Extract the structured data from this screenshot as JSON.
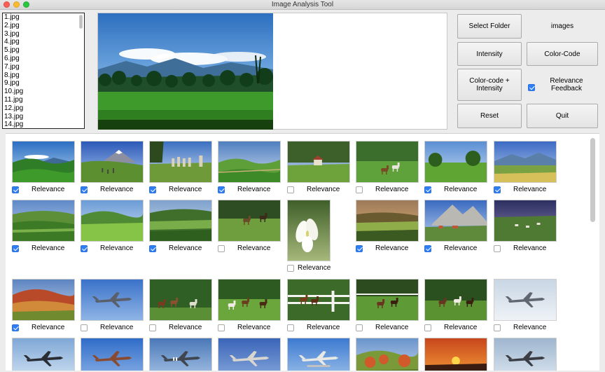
{
  "window": {
    "title": "Image Analysis Tool"
  },
  "file_list": [
    "1.jpg",
    "2.jpg",
    "3.jpg",
    "4.jpg",
    "5.jpg",
    "6.jpg",
    "7.jpg",
    "8.jpg",
    "9.jpg",
    "10.jpg",
    "11.jpg",
    "12.jpg",
    "13.jpg",
    "14.jpg"
  ],
  "controls": {
    "select_folder": "Select Folder",
    "folder_name": "images",
    "intensity": "Intensity",
    "color_code": "Color-Code",
    "color_code_intensity": "Color-code + Intensity",
    "relevance_feedback": "Relevance Feedback",
    "relevance_feedback_checked": true,
    "reset": "Reset",
    "quit": "Quit"
  },
  "gallery": {
    "relevance_label": "Relevance",
    "rows": [
      [
        {
          "scene": "blue-mountain",
          "checked": true
        },
        {
          "scene": "snow-mountain",
          "checked": true
        },
        {
          "scene": "stones-field",
          "checked": true
        },
        {
          "scene": "green-hills",
          "checked": true
        },
        {
          "scene": "tree-house",
          "checked": false
        },
        {
          "scene": "horse-field",
          "checked": false
        },
        {
          "scene": "meadow-trees",
          "checked": true
        },
        {
          "scene": "mountain-lake",
          "checked": true
        }
      ],
      [
        {
          "scene": "rolling-green",
          "checked": true
        },
        {
          "scene": "valley-meadow",
          "checked": true
        },
        {
          "scene": "patchwork-fields",
          "checked": true
        },
        {
          "scene": "rider-field",
          "checked": false
        },
        {
          "scene": "white-flower",
          "checked": false
        },
        {
          "scene": "sunset-fields",
          "checked": true
        },
        {
          "scene": "alpine-village",
          "checked": true
        },
        {
          "scene": "cattle-dusk",
          "checked": false
        }
      ],
      [
        {
          "scene": "red-hills",
          "checked": true
        },
        {
          "scene": "jet-sky",
          "checked": false
        },
        {
          "scene": "horses-woods",
          "checked": false
        },
        {
          "scene": "horses-green",
          "checked": false
        },
        {
          "scene": "horse-fence",
          "checked": false
        },
        {
          "scene": "horses-white-fence",
          "checked": false
        },
        {
          "scene": "horses-trees",
          "checked": false
        },
        {
          "scene": "vintage-plane",
          "checked": false
        }
      ],
      [
        {
          "scene": "bomber-sky",
          "checked": false
        },
        {
          "scene": "fighter-blue",
          "checked": false
        },
        {
          "scene": "striped-plane",
          "checked": false
        },
        {
          "scene": "prop-plane",
          "checked": false
        },
        {
          "scene": "seaplane",
          "checked": false
        },
        {
          "scene": "autumn-hills",
          "checked": false
        },
        {
          "scene": "orange-sunset",
          "checked": false
        },
        {
          "scene": "b17-sky",
          "checked": false
        }
      ]
    ]
  },
  "colors": {
    "checkbox_accent": "#2f7ef6",
    "button_face": "#ececec"
  }
}
